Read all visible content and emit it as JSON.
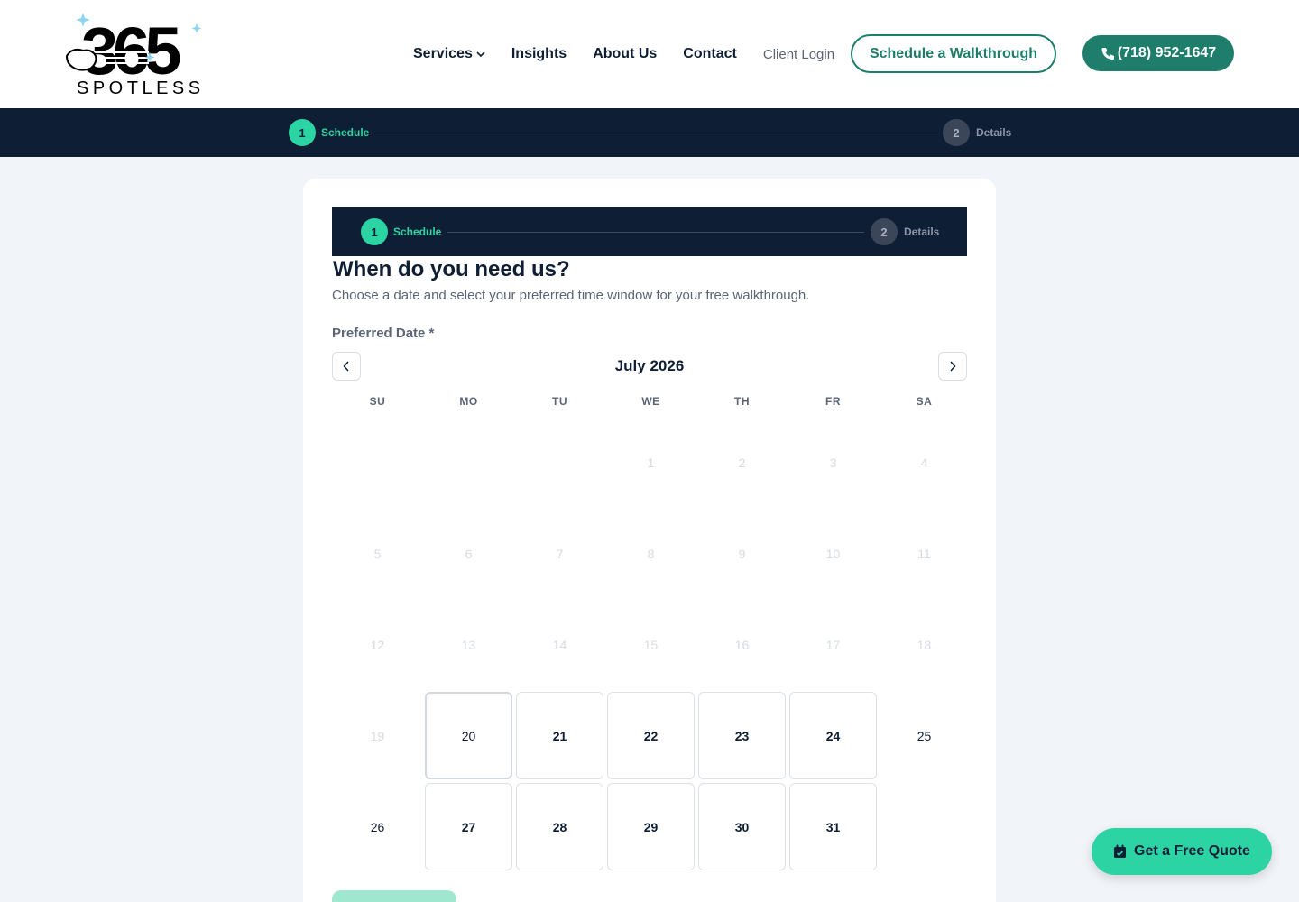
{
  "header": {
    "logo": {
      "number": "365",
      "word": "SPOTLESS",
      "icon": "hand-sparkle-logo"
    },
    "nav": [
      {
        "label": "Services",
        "has_dropdown": true
      },
      {
        "label": "Insights"
      },
      {
        "label": "About Us"
      },
      {
        "label": "Contact"
      }
    ],
    "client_login": "Client Login",
    "walkthrough_button": "Schedule a Walkthrough",
    "phone_button": "(718) 952-1647"
  },
  "stepper": {
    "steps": [
      {
        "number": "1",
        "label": "Schedule",
        "active": true
      },
      {
        "number": "2",
        "label": "Details",
        "active": false
      }
    ]
  },
  "form": {
    "title": "When do you need us?",
    "subtitle": "Choose a date and select your preferred time window for your free walkthrough.",
    "date_label": "Preferred Date *"
  },
  "calendar": {
    "month": "July 2026",
    "weekdays": [
      "SU",
      "MO",
      "TU",
      "WE",
      "TH",
      "FR",
      "SA"
    ],
    "leading_blanks": 3,
    "days": [
      {
        "d": "1",
        "state": "disabled"
      },
      {
        "d": "2",
        "state": "disabled"
      },
      {
        "d": "3",
        "state": "disabled"
      },
      {
        "d": "4",
        "state": "disabled"
      },
      {
        "d": "5",
        "state": "disabled"
      },
      {
        "d": "6",
        "state": "disabled"
      },
      {
        "d": "7",
        "state": "disabled"
      },
      {
        "d": "8",
        "state": "disabled"
      },
      {
        "d": "9",
        "state": "disabled"
      },
      {
        "d": "10",
        "state": "disabled"
      },
      {
        "d": "11",
        "state": "disabled"
      },
      {
        "d": "12",
        "state": "disabled"
      },
      {
        "d": "13",
        "state": "disabled"
      },
      {
        "d": "14",
        "state": "disabled"
      },
      {
        "d": "15",
        "state": "disabled"
      },
      {
        "d": "16",
        "state": "disabled"
      },
      {
        "d": "17",
        "state": "disabled"
      },
      {
        "d": "18",
        "state": "disabled"
      },
      {
        "d": "19",
        "state": "disabled"
      },
      {
        "d": "20",
        "state": "today"
      },
      {
        "d": "21",
        "state": "available"
      },
      {
        "d": "22",
        "state": "available"
      },
      {
        "d": "23",
        "state": "available"
      },
      {
        "d": "24",
        "state": "available"
      },
      {
        "d": "25",
        "state": "plain"
      },
      {
        "d": "26",
        "state": "plain"
      },
      {
        "d": "27",
        "state": "available"
      },
      {
        "d": "28",
        "state": "available"
      },
      {
        "d": "29",
        "state": "available"
      },
      {
        "d": "30",
        "state": "available"
      },
      {
        "d": "31",
        "state": "available"
      }
    ]
  },
  "fab": {
    "label": "Get a Free Quote",
    "icon": "calendar-check-icon"
  },
  "colors": {
    "brand_green": "#1e7d6b",
    "accent_mint": "#2dd4a3",
    "navy": "#0e1e35",
    "page_bg": "#f1f4f8"
  }
}
